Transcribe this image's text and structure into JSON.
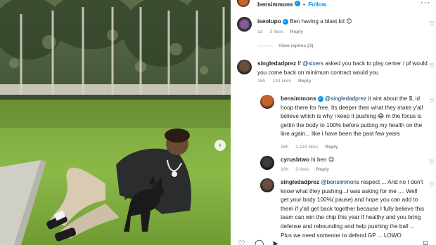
{
  "media": {
    "next_icon": "chevron-right-icon"
  },
  "header": {
    "username": "bensimmons",
    "verified_icon": "verified-badge-icon",
    "separator": "•",
    "follow_label": "Follow",
    "more_label": "···"
  },
  "comments": [
    {
      "username": "iseolupo",
      "verified": true,
      "text": "Ben having a blast lol",
      "emoji": "😊",
      "time": "1d",
      "likes": "3 likes",
      "reply": "Reply"
    },
    {
      "username": "singledadprez",
      "verified": false,
      "text_before": "If ",
      "mention": "@sixers",
      "text_after": " asked you back to play center / pf would you come back on minimum contract would you",
      "time": "16h",
      "likes": "133 likes",
      "reply": "Reply"
    },
    {
      "username": "bensimmons",
      "verified": true,
      "mention": "@singledadprez",
      "text_a": " it aint about the $, id hoop there for free. Its deeper then what they make y'all believe which is why i keep it pushing ",
      "emoji": "😂",
      "text_b": " m the focus is gettin the body to 100% before putting my health on the line again... like i have been the past few years",
      "time": "16h",
      "likes": "1,116 likes",
      "reply": "Reply"
    },
    {
      "username": "cyrusbtwo",
      "verified": false,
      "text": "hi ben ",
      "emoji": "😊",
      "time": "16h",
      "likes": "3 likes",
      "reply": "Reply"
    },
    {
      "username": "singledadprez",
      "verified": false,
      "mention": "@bensimmons",
      "text": " respect ... And no I don't know what they pushing...I was asking for me .... Well get your body 100%( pause) and hope you can add to them if y'all get back together because I fully believe this team can win the chip this year if healthy and you bring defense and rebounding and help pushing the ball ... Plus we need someone to defend",
      "text_tail": "GP ... LOWO"
    }
  ],
  "view_replies": "View replies (3)",
  "icons": {
    "like": "heart-icon",
    "comment": "comment-icon",
    "share": "share-icon",
    "save": "bookmark-icon"
  },
  "colors": {
    "link_blue": "#0095f6",
    "mention": "#00376b",
    "meta_gray": "#8e8e8e"
  }
}
